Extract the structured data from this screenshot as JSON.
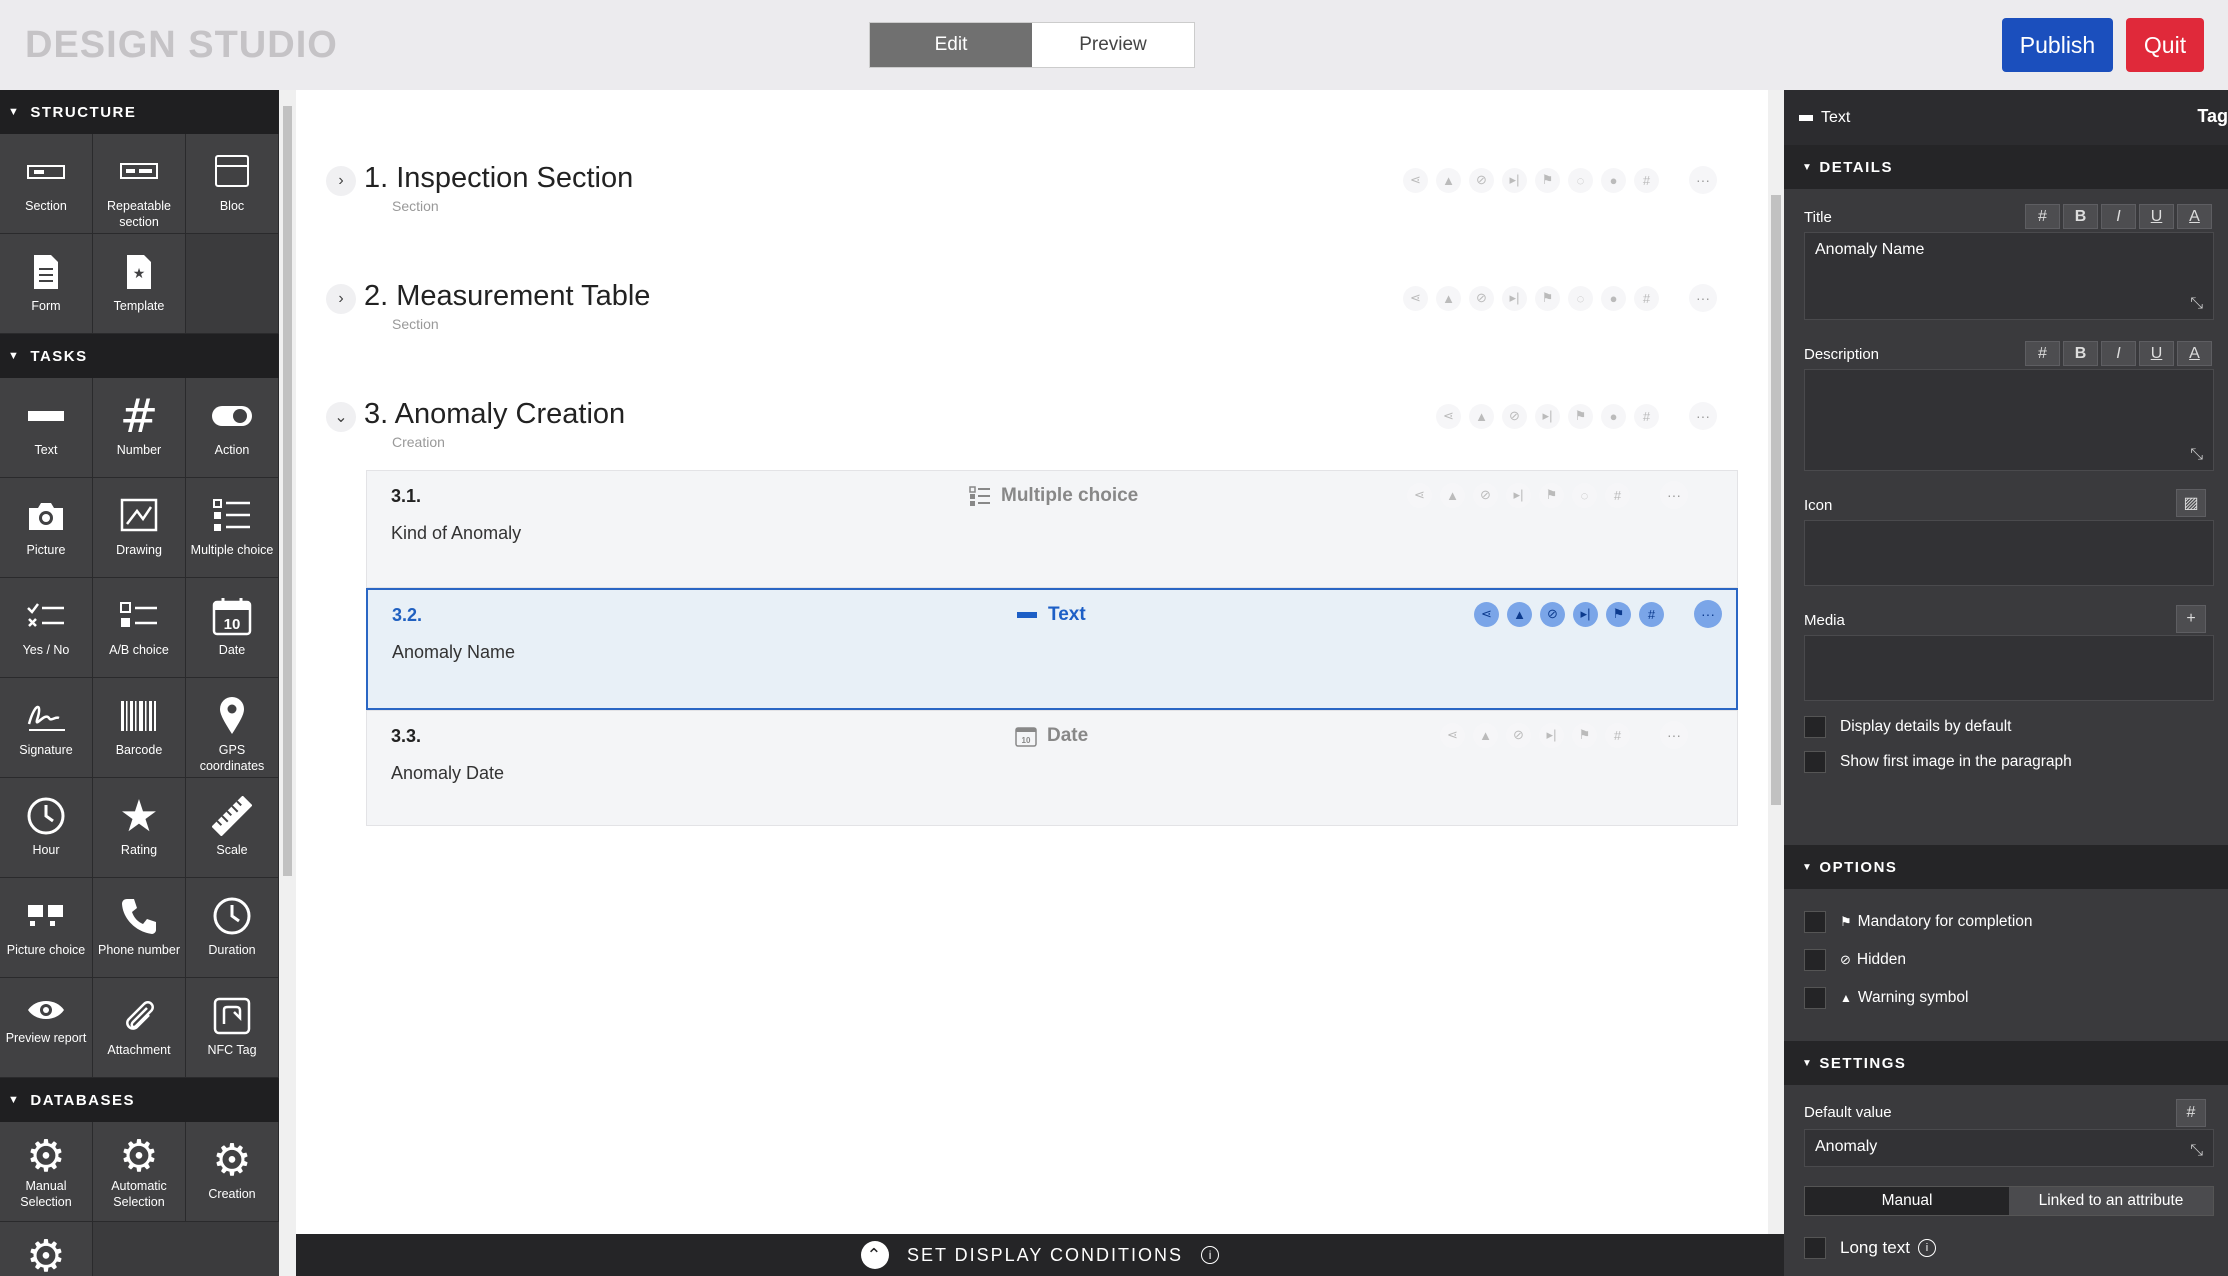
{
  "header": {
    "app_title": "DESIGN STUDIO",
    "mode_edit": "Edit",
    "mode_preview": "Preview",
    "publish": "Publish",
    "quit": "Quit"
  },
  "palette": {
    "structure": {
      "heading": "STRUCTURE",
      "items": [
        {
          "label": "Section",
          "icon": "section-icon"
        },
        {
          "label": "Repeatable section",
          "icon": "repeatable-section-icon"
        },
        {
          "label": "Bloc",
          "icon": "bloc-icon"
        },
        {
          "label": "Form",
          "icon": "form-icon"
        },
        {
          "label": "Template",
          "icon": "template-icon"
        }
      ]
    },
    "tasks": {
      "heading": "TASKS",
      "items": [
        {
          "label": "Text",
          "icon": "text-icon"
        },
        {
          "label": "Number",
          "icon": "number-icon"
        },
        {
          "label": "Action",
          "icon": "toggle-icon"
        },
        {
          "label": "Picture",
          "icon": "camera-icon"
        },
        {
          "label": "Drawing",
          "icon": "drawing-icon"
        },
        {
          "label": "Multiple choice",
          "icon": "checklist-icon"
        },
        {
          "label": "Yes / No",
          "icon": "yes-no-icon"
        },
        {
          "label": "A/B choice",
          "icon": "ab-choice-icon"
        },
        {
          "label": "Date",
          "icon": "calendar-icon"
        },
        {
          "label": "Signature",
          "icon": "signature-icon"
        },
        {
          "label": "Barcode",
          "icon": "barcode-icon"
        },
        {
          "label": "GPS coordinates",
          "icon": "map-pin-icon"
        },
        {
          "label": "Hour",
          "icon": "clock-icon"
        },
        {
          "label": "Rating",
          "icon": "star-icon"
        },
        {
          "label": "Scale",
          "icon": "ruler-icon"
        },
        {
          "label": "Picture choice",
          "icon": "picture-choice-icon"
        },
        {
          "label": "Phone number",
          "icon": "phone-icon"
        },
        {
          "label": "Duration",
          "icon": "duration-icon"
        },
        {
          "label": "Preview report",
          "icon": "eye-icon"
        },
        {
          "label": "Attachment",
          "icon": "paperclip-icon"
        },
        {
          "label": "NFC Tag",
          "icon": "nfc-icon"
        }
      ]
    },
    "databases": {
      "heading": "DATABASES",
      "items": [
        {
          "label": "Manual Selection",
          "icon": "gear-icon"
        },
        {
          "label": "Automatic Selection",
          "icon": "gear-icon"
        },
        {
          "label": "Creation",
          "icon": "gear-icon"
        }
      ]
    }
  },
  "canvas": {
    "sections": [
      {
        "title": "1. Inspection Section",
        "subtitle": "Section",
        "expanded": false
      },
      {
        "title": "2. Measurement Table",
        "subtitle": "Section",
        "expanded": false
      },
      {
        "title": "3. Anomaly Creation",
        "subtitle": "Creation",
        "expanded": true
      }
    ],
    "questions": [
      {
        "number": "3.1.",
        "type": "Multiple choice",
        "text": "Kind of Anomaly",
        "selected": false
      },
      {
        "number": "3.2.",
        "type": "Text",
        "text": "Anomaly Name",
        "selected": true
      },
      {
        "number": "3.3.",
        "type": "Date",
        "text": "Anomaly Date",
        "selected": false
      }
    ],
    "bottom_bar": "SET DISPLAY CONDITIONS"
  },
  "properties": {
    "top_type": "Text",
    "top_tag": "Tag",
    "details_heading": "DETAILS",
    "title_label": "Title",
    "title_value": "Anomaly Name",
    "description_label": "Description",
    "description_value": "",
    "icon_label": "Icon",
    "media_label": "Media",
    "display_details": "Display details by default",
    "show_first_image": "Show first image in the paragraph",
    "options_heading": "OPTIONS",
    "mandatory": "Mandatory for completion",
    "hidden": "Hidden",
    "warning": "Warning symbol",
    "settings_heading": "SETTINGS",
    "default_value_label": "Default value",
    "default_value": "Anomaly",
    "seg_manual": "Manual",
    "seg_linked": "Linked to an attribute",
    "long_text": "Long text"
  },
  "colors": {
    "publish": "#1b4fbd",
    "quit": "#e0293a",
    "selection": "#2a66c4",
    "palette_bg": "#3b3b3d"
  }
}
